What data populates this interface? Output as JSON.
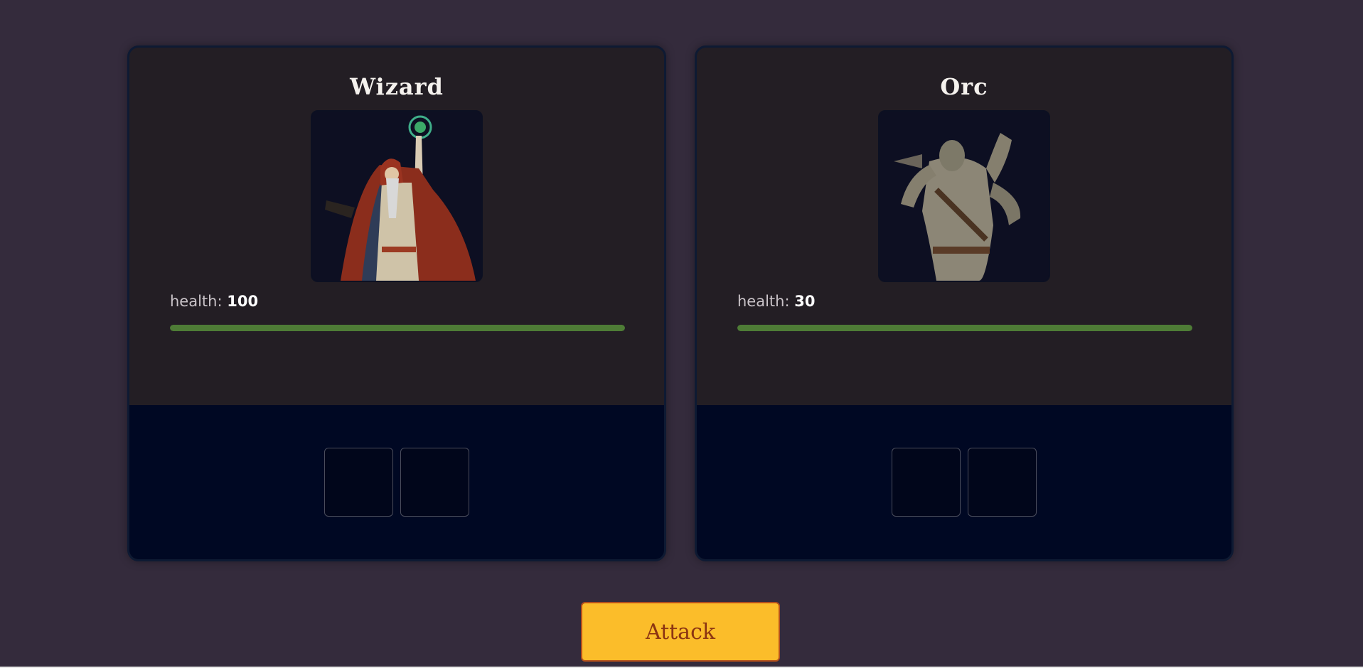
{
  "players": [
    {
      "name": "Wizard",
      "health_label": "health:",
      "health_value": "100",
      "health_fraction": 1.0,
      "portrait_icon": "wizard-portrait",
      "dice_slots": 2
    },
    {
      "name": "Orc",
      "health_label": "health:",
      "health_value": "30",
      "health_fraction": 1.0,
      "portrait_icon": "orc-portrait",
      "dice_slots": 2
    }
  ],
  "attack_button": {
    "label": "Attack"
  },
  "colors": {
    "background": "#342b3c",
    "card_top": "#231e24",
    "card_bottom": "#000823",
    "health_bar": "#4e7c36",
    "button": "#fbbd2a",
    "button_text": "#8c3512"
  }
}
